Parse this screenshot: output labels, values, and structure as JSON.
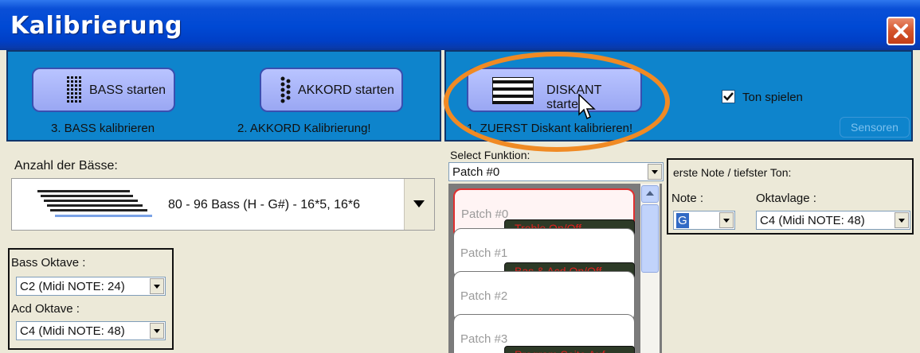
{
  "window": {
    "title": "Kalibrierung",
    "close_icon": "close-icon"
  },
  "toolbar_left": {
    "bass_button": "BASS starten",
    "bass_caption": "3. BASS kalibrieren",
    "akkord_button": "AKKORD starten",
    "akkord_caption": "2. AKKORD Kalibrierung!"
  },
  "toolbar_right": {
    "diskant_button": "DISKANT starten",
    "diskant_caption": "1. ZUERST Diskant kalibrieren!",
    "ton_spielen_label": "Ton spielen",
    "ton_spielen_checked": true,
    "sensoren_label": "Sensoren"
  },
  "bass_section": {
    "anzahl_label": "Anzahl der Bässe:",
    "bass_selection": "80 - 96 Bass (H - G#)  - 16*5, 16*6",
    "bass_oktave_label": "Bass Oktave :",
    "bass_oktave_value": "C2  (Midi NOTE: 24)",
    "acd_oktave_label": "Acd Oktave :",
    "acd_oktave_value": "C4  (Midi NOTE: 48)"
  },
  "funktion_section": {
    "select_label": "Select Funktion:",
    "selected_value": "Patch #0",
    "patches": [
      {
        "name": "Patch #0",
        "tag": "Treble  On/Off"
      },
      {
        "name": "Patch #1",
        "tag": "Bas & Acd On/Off"
      },
      {
        "name": "Patch #2",
        "tag": ""
      },
      {
        "name": "Patch #3",
        "tag": "Program Seite Auf"
      }
    ]
  },
  "note_section": {
    "title": "erste Note / tiefster Ton:",
    "note_label": "Note :",
    "note_value": "G",
    "oktavlage_label": "Oktavlage :",
    "oktavlage_value": "C4  (Midi NOTE: 48)"
  },
  "colors": {
    "titlebar": "#0049d4",
    "toolbar_blue": "#0e84cc",
    "button_fill": "#9aa7f3",
    "annotation_orange": "#f08a24",
    "patch_tag_text": "#e02020"
  }
}
